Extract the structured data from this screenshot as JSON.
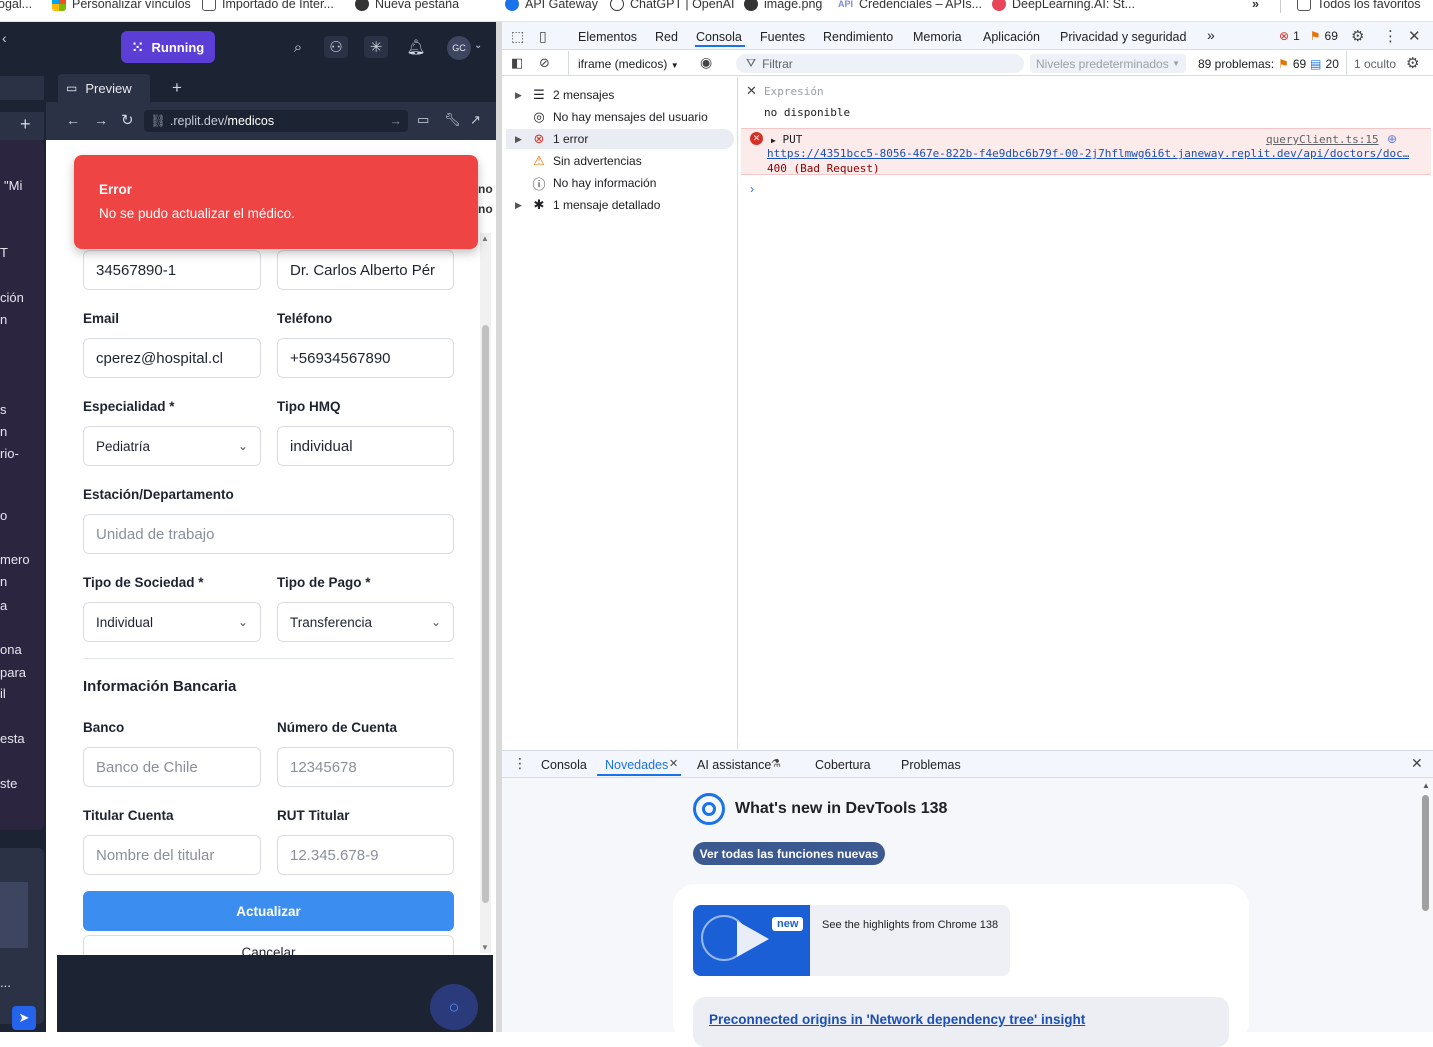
{
  "bookmarks": [
    {
      "label": "ogal...",
      "icon": "none"
    },
    {
      "label": "Personalizar vínculos",
      "icon": "windows-icon"
    },
    {
      "label": "Importado de Inter...",
      "icon": "folder-icon"
    },
    {
      "label": "Nueva pestaña",
      "icon": "globe-icon"
    },
    {
      "label": "API Gateway",
      "icon": "cloud-icon"
    },
    {
      "label": "ChatGPT | OpenAI",
      "icon": "openai-icon"
    },
    {
      "label": "image.png",
      "icon": "globe-icon"
    },
    {
      "label": "Credenciales – APIs...",
      "icon": "api-icon"
    },
    {
      "label": "DeepLearning.AI: St...",
      "icon": "deeplearning-icon"
    },
    {
      "label": "»",
      "icon": "none"
    },
    {
      "label": "Todos los favoritos",
      "icon": "folder-icon"
    }
  ],
  "replit": {
    "status_label": "Running",
    "avatar_initials": "GC",
    "preview_tab_label": "Preview",
    "url_prefix": ".replit.dev/",
    "url_path": "medicos"
  },
  "left_panel_fragments": [
    "\"Mi",
    "T",
    "ción",
    "n",
    "s",
    "n",
    "rio-",
    "o",
    "mero",
    "n",
    "a",
    "ona",
    "para",
    "il",
    "esta",
    "ste",
    "..."
  ],
  "toast": {
    "title": "Error",
    "message": "No se pudo actualizar el médico."
  },
  "form": {
    "rut_value": "34567890-1",
    "name_value": "Dr. Carlos Alberto Pér",
    "email_label": "Email",
    "email_value": "cperez@hospital.cl",
    "phone_label": "Teléfono",
    "phone_value": "+56934567890",
    "specialty_label": "Especialidad *",
    "specialty_value": "Pediatría",
    "hmq_label": "Tipo HMQ",
    "hmq_value": "individual",
    "station_label": "Estación/Departamento",
    "station_placeholder": "Unidad de trabajo",
    "society_label": "Tipo de Sociedad *",
    "society_value": "Individual",
    "payment_label": "Tipo de Pago *",
    "payment_value": "Transferencia",
    "bank_section_title": "Información Bancaria",
    "bank_label": "Banco",
    "bank_placeholder": "Banco de Chile",
    "account_label": "Número de Cuenta",
    "account_placeholder": "12345678",
    "holder_label": "Titular Cuenta",
    "holder_placeholder": "Nombre del titular",
    "holder_rut_label": "RUT Titular",
    "holder_rut_placeholder": "12.345.678-9",
    "update_button": "Actualizar",
    "cancel_button": "Cancelar"
  },
  "devtools": {
    "tabs": [
      "Elementos",
      "Red",
      "Consola",
      "Fuentes",
      "Rendimiento",
      "Memoria",
      "Aplicación",
      "Privacidad y seguridad"
    ],
    "active_tab": "Consola",
    "error_count": "1",
    "warning_count": "69",
    "context": "iframe (medicos)",
    "filter_placeholder": "Filtrar",
    "levels": "Niveles predeterminados",
    "problems_label": "89 problemas:",
    "problems_warnings": "69",
    "problems_info": "20",
    "hidden_label": "1 oculto",
    "sidebar": [
      {
        "label": "2 mensajes",
        "icon": "list-icon",
        "expandable": true
      },
      {
        "label": "No hay mensajes del usuario",
        "icon": "user-icon",
        "expandable": false
      },
      {
        "label": "1 error",
        "icon": "error-icon",
        "expandable": true
      },
      {
        "label": "Sin advertencias",
        "icon": "warning-icon",
        "expandable": false
      },
      {
        "label": "No hay información",
        "icon": "info-icon",
        "expandable": false
      },
      {
        "label": "1 mensaje detallado",
        "icon": "bug-icon",
        "expandable": true
      }
    ],
    "expression_label": "Expresión",
    "expression_value": "no disponible",
    "error_method": "PUT",
    "error_source": "queryClient.ts:15",
    "error_url": "https://4351bcc5-8056-467e-822b-f4e9dbc6b79f-00-2j7hflmwg6i6t.janeway.replit.dev/api/doctors/doc…",
    "error_status": "400 (Bad Request)",
    "drawer_tabs": [
      "Consola",
      "Novedades",
      "AI assistance",
      "Cobertura",
      "Problemas"
    ],
    "drawer_active": "Novedades",
    "whatsnew_title": "What's new in DevTools 138",
    "whatsnew_button": "Ver todas las funciones nuevas",
    "video_badge": "new",
    "video_caption": "See the highlights from Chrome 138",
    "feature_link": "Preconnected origins in 'Network dependency tree' insight"
  },
  "colors": {
    "replit_dark": "#1c2333",
    "running_purple": "#5b3ed6",
    "toast_red": "#ef4444",
    "primary_blue": "#3b8ef0",
    "devtools_blue": "#1a73e8"
  }
}
